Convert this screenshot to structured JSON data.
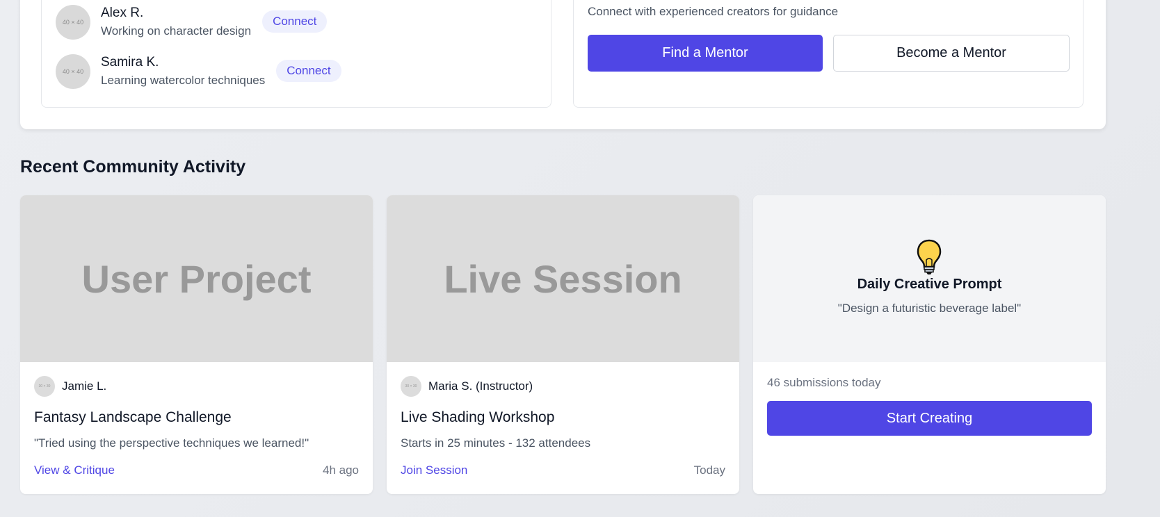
{
  "peers": [
    {
      "avatar_text": "40 × 40",
      "name": "Alex R.",
      "activity": "Working on character design",
      "action": "Connect"
    },
    {
      "avatar_text": "40 × 40",
      "name": "Samira K.",
      "activity": "Learning watercolor techniques",
      "action": "Connect"
    }
  ],
  "mentorship": {
    "description": "Connect with experienced creators for guidance",
    "find_label": "Find a Mentor",
    "become_label": "Become a Mentor"
  },
  "section_title": "Recent Community Activity",
  "cards": [
    {
      "image_label": "User Project",
      "avatar_text": "30 × 30",
      "author": "Jamie L.",
      "title": "Fantasy Landscape Challenge",
      "description": "\"Tried using the perspective techniques we learned!\"",
      "link": "View & Critique",
      "time": "4h ago"
    },
    {
      "image_label": "Live Session",
      "avatar_text": "30 × 30",
      "author": "Maria S. (Instructor)",
      "title": "Live Shading Workshop",
      "description": "Starts in 25 minutes - 132 attendees",
      "link": "Join Session",
      "time": "Today"
    }
  ],
  "prompt": {
    "icon": "lightbulb-icon",
    "title": "Daily Creative Prompt",
    "quote": "\"Design a futuristic beverage label\"",
    "submissions": "46 submissions today",
    "button": "Start Creating"
  },
  "colors": {
    "accent": "#4f46e5",
    "accent_light": "#eef0fd",
    "placeholder": "#dcdcdc"
  }
}
